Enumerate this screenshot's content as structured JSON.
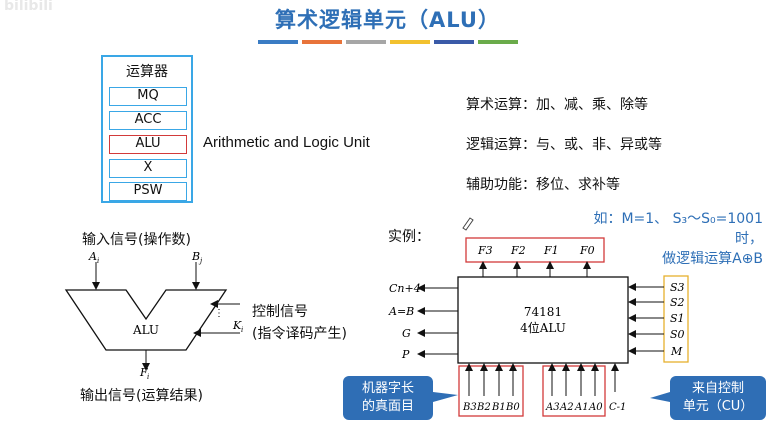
{
  "watermark": "bilibili",
  "title": "算术逻辑单元（ALU）",
  "color_bars": [
    "#3a7cc4",
    "#e8733a",
    "#a6a6a6",
    "#f2c12e",
    "#3a5aa8",
    "#6aab4a"
  ],
  "cpu": {
    "label": "运算器",
    "registers": [
      "MQ",
      "ACC",
      "ALU",
      "X",
      "PSW"
    ],
    "highlighted": "ALU"
  },
  "alu_fullname": "Arithmetic and Logic Unit",
  "features": [
    "算术运算：加、减、乘、除等",
    "逻辑运算：与、或、非、异或等",
    "辅助功能：移位、求补等"
  ],
  "alu_diagram": {
    "input_label": "输入信号(操作数)",
    "input_a": "A",
    "input_a_sub": "i",
    "input_b": "B",
    "input_b_sub": "j",
    "body_label": "ALU",
    "control_label_1": "控制信号",
    "control_label_2": "(指令译码产生)",
    "control_var": "K",
    "control_sub": "i",
    "output_var": "F",
    "output_sub": "i",
    "output_label": "输出信号(运算结果)"
  },
  "example": {
    "label": "实例：",
    "hint_line1": "如：M=1、 S₃～S₀=1001时，",
    "hint_line2": "做逻辑运算A⊕B",
    "chip_name": "74181",
    "chip_desc": "4位ALU",
    "outputs_top": [
      "F3",
      "F2",
      "F1",
      "F0"
    ],
    "left_pins": [
      "Cn+4",
      "A=B",
      "G",
      "P"
    ],
    "right_pins": [
      "S3",
      "S2",
      "S1",
      "S0",
      "M"
    ],
    "bottom_b": [
      "B3",
      "B2",
      "B1",
      "B0"
    ],
    "bottom_a": [
      "A3",
      "A2",
      "A1",
      "A0"
    ],
    "carry_in": "C-1"
  },
  "callouts": {
    "left_1": "机器字长",
    "left_2": "的真面目",
    "right_1": "来自控制",
    "right_2": "单元（CU）"
  }
}
